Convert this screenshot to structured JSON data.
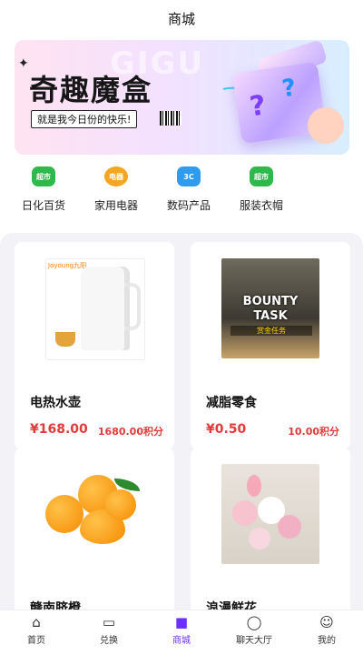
{
  "header": {
    "title": "商城"
  },
  "banner": {
    "ghost_text": "GIGU",
    "title": "奇趣魔盒",
    "subtitle": "就是我今日份的快乐!"
  },
  "categories": [
    {
      "label": "日化百货",
      "icon_text": "超市",
      "color": "#2fb84c"
    },
    {
      "label": "家用电器",
      "icon_text": "电器",
      "color": "#f5a623"
    },
    {
      "label": "数码产品",
      "icon_text": "3C",
      "color": "#2f9bef"
    },
    {
      "label": "服装衣帽",
      "icon_text": "超市",
      "color": "#2fb84c"
    }
  ],
  "products": [
    {
      "name": "电热水壶",
      "price": "¥168.00",
      "points": "1680.00积分",
      "image_text": "Joyoung九阳"
    },
    {
      "name": "减脂零食",
      "price": "¥0.50",
      "points": "10.00积分",
      "image_text1": "BOUNTY",
      "image_text2": "TASK",
      "image_text3": "赏金任务"
    },
    {
      "name": "赣南脐橙"
    },
    {
      "name": "浪漫鲜花"
    }
  ],
  "tabs": [
    {
      "label": "首页",
      "icon": "home-icon"
    },
    {
      "label": "兑换",
      "icon": "exchange-icon"
    },
    {
      "label": "商城",
      "icon": "shop-bag-icon",
      "active": true
    },
    {
      "label": "聊天大厅",
      "icon": "chat-icon"
    },
    {
      "label": "我的",
      "icon": "profile-icon"
    }
  ],
  "colors": {
    "accent": "#6b2fff",
    "price": "#e23b3b"
  }
}
